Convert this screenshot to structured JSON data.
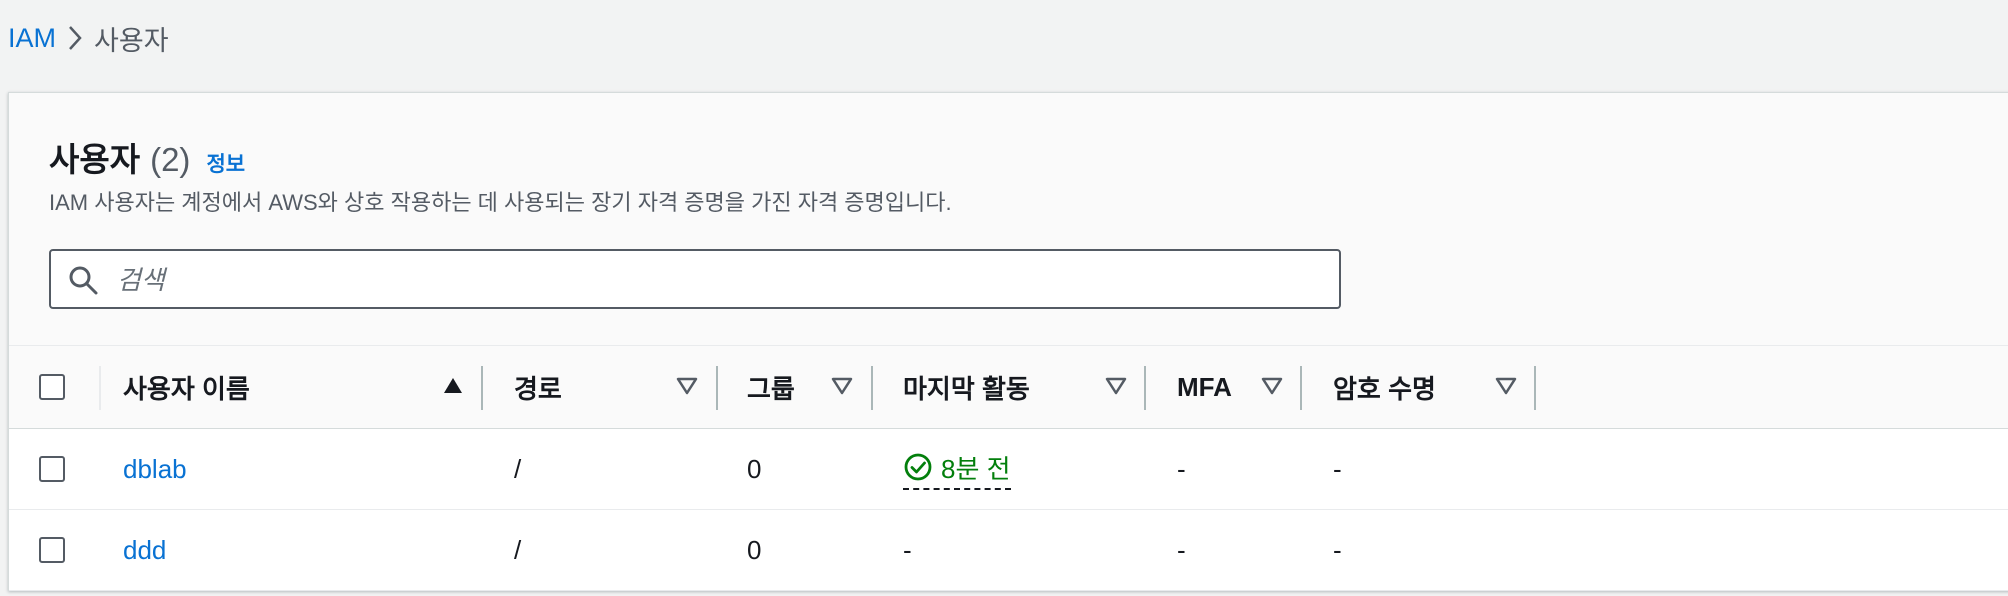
{
  "breadcrumb": {
    "root": "IAM",
    "separator_icon": "chevron-right-icon",
    "current": "사용자"
  },
  "panel": {
    "title": "사용자",
    "count": "(2)",
    "info_link": "정보",
    "description": "IAM 사용자는 계정에서 AWS와 상호 작용하는 데 사용되는 장기 자격 증명을 가진 자격 증명입니다."
  },
  "search": {
    "placeholder": "검색",
    "icon": "search-icon"
  },
  "table": {
    "columns": {
      "username": "사용자 이름",
      "path": "경로",
      "groups": "그룹",
      "last_activity": "마지막 활동",
      "mfa": "MFA",
      "password_age": "암호 수명"
    },
    "sort_column": "username",
    "rows": [
      {
        "username": "dblab",
        "path": "/",
        "groups": "0",
        "last_activity": "8분 전",
        "last_activity_status": "success",
        "mfa": "-",
        "password_age": "-"
      },
      {
        "username": "ddd",
        "path": "/",
        "groups": "0",
        "last_activity": "-",
        "mfa": "-",
        "password_age": "-"
      }
    ]
  },
  "colors": {
    "link": "#0972d3",
    "success": "#037f0c",
    "text": "#16191f",
    "secondary": "#545b64"
  }
}
